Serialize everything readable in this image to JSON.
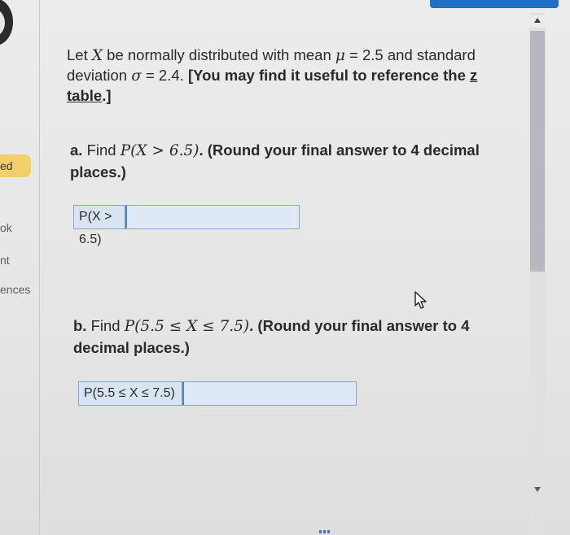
{
  "sidebar": {
    "badge_label": "ed",
    "items": [
      "ok",
      "nt",
      "ences"
    ]
  },
  "question": {
    "prefix": "Let ",
    "var_x": "X",
    "text1": " be normally distributed with mean ",
    "mu": "μ",
    "mu_value": " = 2.5 and standard deviation ",
    "sigma": "σ",
    "sigma_value": " = 2.4. ",
    "hint_prefix": "[You may find it useful to reference the ",
    "link_text": "z table",
    "hint_suffix": ".]"
  },
  "part_a": {
    "letter": "a.",
    "find": " Find ",
    "expr": "P(X > 6.5)",
    "instruction": ". (Round your final answer to 4 decimal places.)",
    "answer_label": "P(X > 6.5)",
    "answer_value": ""
  },
  "part_b": {
    "letter": "b.",
    "find": " Find ",
    "expr": "P(5.5 ≤ X ≤ 7.5)",
    "instruction": ". (Round your final answer to 4 decimal places.)",
    "answer_label": "P(5.5 ≤ X ≤ 7.5)",
    "answer_value": ""
  },
  "colors": {
    "accent": "#1f6fc4",
    "badge": "#f3cf6b",
    "input_bg": "#dfe9f6"
  },
  "icons": {
    "cursor": "mouse-pointer-icon",
    "scroll_up": "chevron-up-icon",
    "scroll_down": "chevron-down-icon"
  }
}
